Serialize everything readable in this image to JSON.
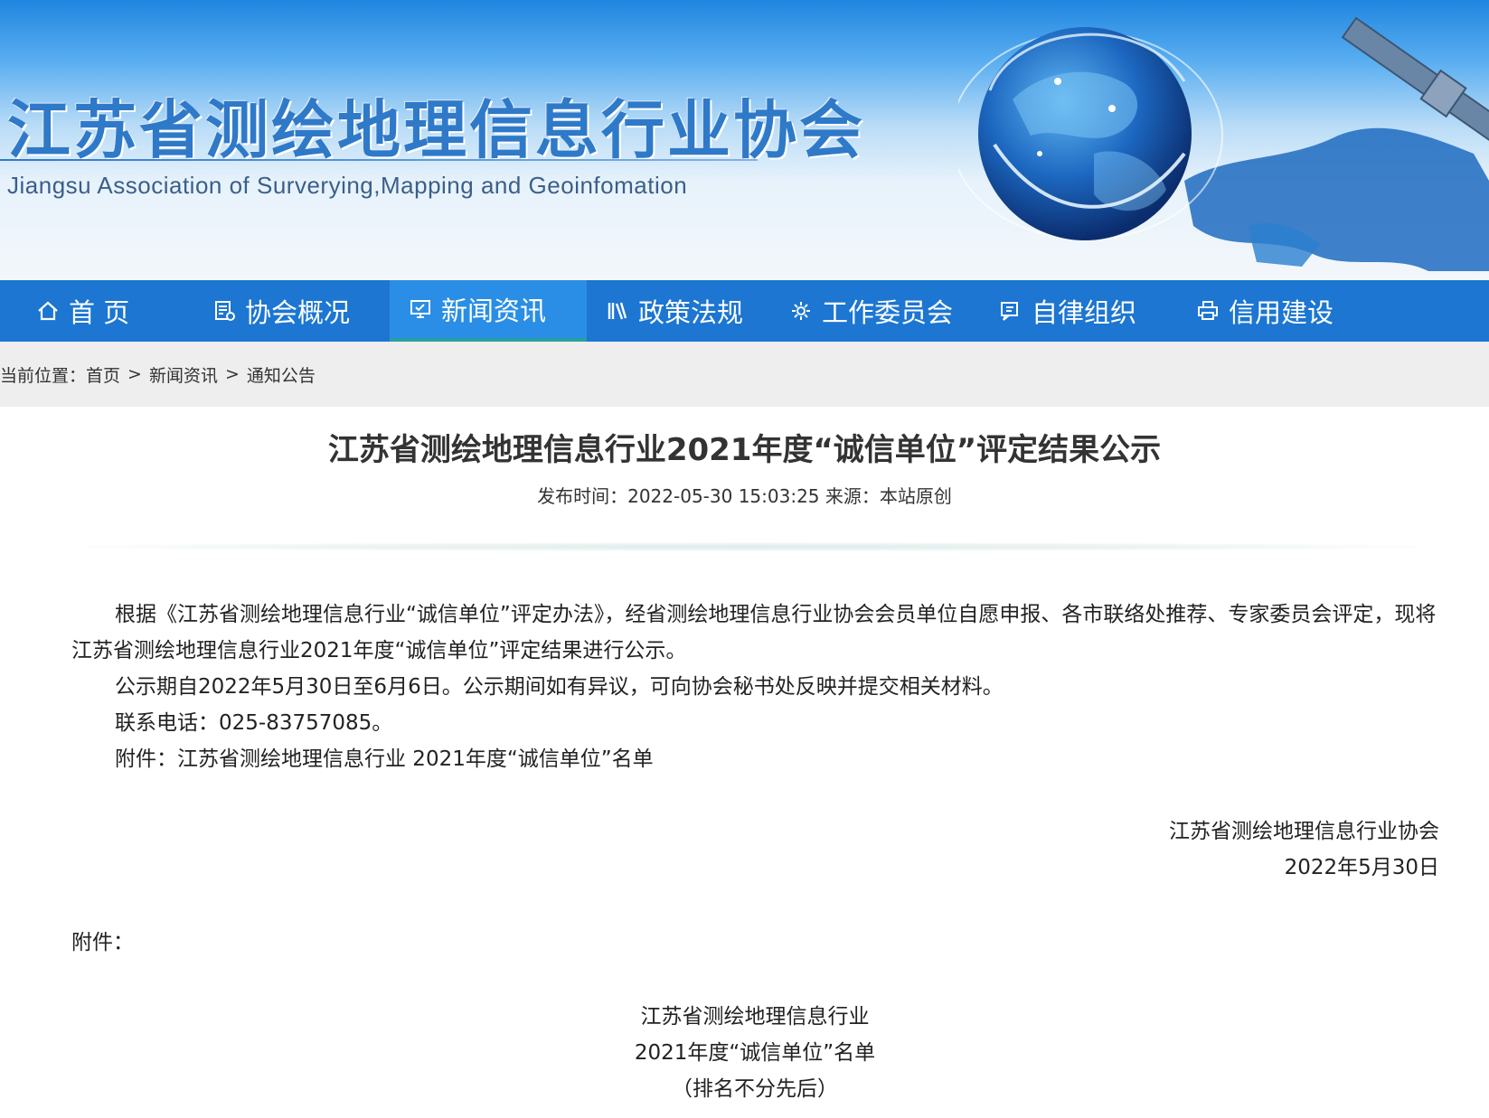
{
  "header": {
    "site_title": "江苏省测绘地理信息行业协会",
    "site_subtitle": "Jiangsu Association of Surverying,Mapping and Geoinfomation"
  },
  "nav": {
    "items": [
      {
        "label": "首 页",
        "icon": "home-icon"
      },
      {
        "label": "协会概况",
        "icon": "document-gear-icon"
      },
      {
        "label": "新闻资讯",
        "icon": "monitor-icon",
        "active": true
      },
      {
        "label": "政策法规",
        "icon": "books-icon"
      },
      {
        "label": "工作委员会",
        "icon": "gear-icon"
      },
      {
        "label": "自律组织",
        "icon": "chat-icon"
      },
      {
        "label": "信用建设",
        "icon": "printer-icon"
      }
    ]
  },
  "breadcrumb": {
    "prefix": "当前位置：",
    "items": [
      "首页",
      "新闻资讯",
      "通知公告"
    ],
    "separator": ">"
  },
  "article": {
    "title": "江苏省测绘地理信息行业2021年度“诚信单位”评定结果公示",
    "meta": "发布时间：2022-05-30 15:03:25  来源：本站原创",
    "paragraphs": [
      "根据《江苏省测绘地理信息行业“诚信单位”评定办法》，经省测绘地理信息行业协会会员单位自愿申报、各市联络处推荐、专家委员会评定，现将江苏省测绘地理信息行业2021年度“诚信单位”评定结果进行公示。",
      "公示期自2022年5月30日至6月6日。公示期间如有异议，可向协会秘书处反映并提交相关材料。",
      "联系电话：025-83757085。",
      "附件：江苏省测绘地理信息行业 2021年度“诚信单位”名单"
    ],
    "signature_org": "江苏省测绘地理信息行业协会",
    "signature_date": "2022年5月30日",
    "attachment_heading": "附件：",
    "list_title_line1": "江苏省测绘地理信息行业",
    "list_title_line2": "2021年度“诚信单位”名单",
    "list_note": "（排名不分先后）"
  },
  "colors": {
    "nav_bg": "#1c76d2",
    "nav_active": "#2a8ee6",
    "title_blue": "#2f79c9",
    "crumb_bg": "#eeeeee"
  }
}
